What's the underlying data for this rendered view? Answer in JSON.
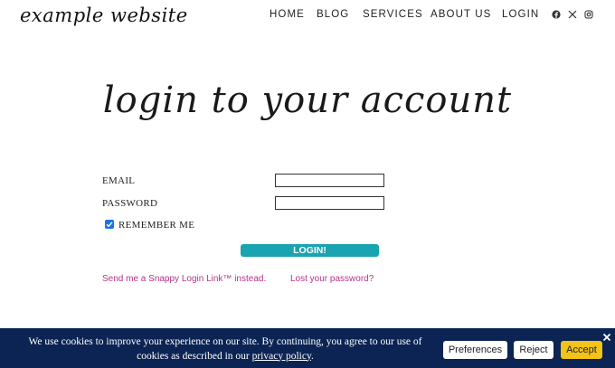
{
  "header": {
    "logo": "example website",
    "nav": [
      "HOME",
      "BLOG",
      "SERVICES",
      "ABOUT US",
      "LOGIN"
    ],
    "social_icons": [
      "facebook-icon",
      "x-icon",
      "instagram-icon"
    ]
  },
  "main": {
    "title": "login to your account",
    "form": {
      "email_label": "EMAIL",
      "email_value": "",
      "password_label": "PASSWORD",
      "password_value": "",
      "remember_label": "REMEMBER ME",
      "remember_checked": true,
      "submit_label": "LOGIN!"
    },
    "links": {
      "snappy": "Send me a Snappy Login Link™ instead.",
      "lost": "Lost your password?"
    }
  },
  "cookie_banner": {
    "text_before": "We use cookies to improve your experience on our site. By continuing, you agree to our use of cookies as described in our ",
    "policy_link": "privacy policy",
    "text_after": ".",
    "buttons": {
      "preferences": "Preferences",
      "reject": "Reject",
      "accept": "Accept"
    }
  },
  "colors": {
    "accent": "#1aa3b0",
    "link": "#b5338a",
    "banner": "#0b2454",
    "accept": "#f3c318"
  }
}
